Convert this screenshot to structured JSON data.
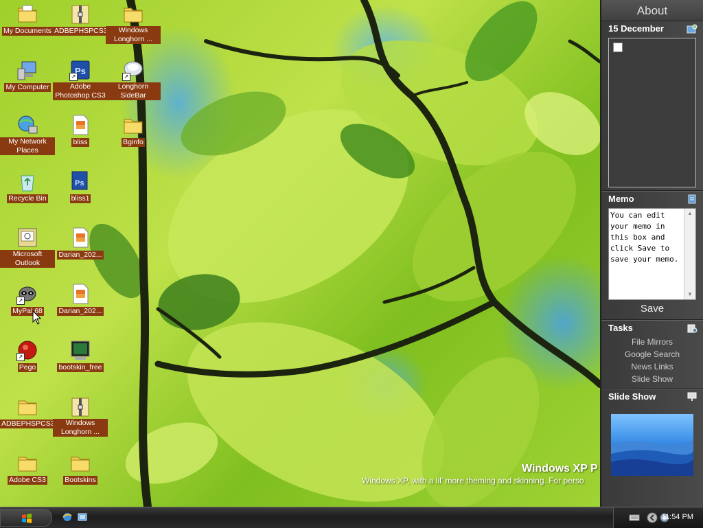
{
  "desktop_icons": [
    {
      "label": "My Documents",
      "icon": "my-documents-icon"
    },
    {
      "label": "ADBEPHSPCS3",
      "icon": "folder-zip-icon"
    },
    {
      "label": "Windows Longhorn ...",
      "icon": "folder-icon"
    },
    {
      "label": "My Computer",
      "icon": "computer-icon"
    },
    {
      "label": "Adobe Photoshop CS3",
      "icon": "photoshop-icon"
    },
    {
      "label": "Longhorn SideBar",
      "icon": "sidebar-app-icon"
    },
    {
      "label": "My Network Places",
      "icon": "network-icon"
    },
    {
      "label": "bliss",
      "icon": "image-file-icon"
    },
    {
      "label": "Bginfo",
      "icon": "folder-icon"
    },
    {
      "label": "Recycle Bin",
      "icon": "recycle-bin-icon"
    },
    {
      "label": "bliss1",
      "icon": "psd-file-icon"
    },
    {
      "label": "Microsoft Outlook",
      "icon": "outlook-icon"
    },
    {
      "label": "Darian_202...",
      "icon": "image-file-icon"
    },
    {
      "label": "MyPal 68",
      "icon": "raccoon-app-icon"
    },
    {
      "label": "Darian_202...",
      "icon": "image-file-icon"
    },
    {
      "label": "Pego",
      "icon": "pego-icon"
    },
    {
      "label": "bootskin_free",
      "icon": "bootskin-icon"
    },
    {
      "label": "ADBEPHSPCS3",
      "icon": "folder-icon"
    },
    {
      "label": "Windows Longhorn ...",
      "icon": "folder-zip-icon"
    },
    {
      "label": "Adobe CS3",
      "icon": "folder-icon"
    },
    {
      "label": "Bootskins",
      "icon": "folder-icon"
    }
  ],
  "watermark": {
    "title": "Windows XP P",
    "subtitle": "Windows XP, with a lil' more theming and skinning. For perso"
  },
  "sidebar": {
    "about_label": "About",
    "calendar": {
      "date_label": "15 December"
    },
    "memo": {
      "title": "Memo",
      "text": "You can edit your memo in this box and click Save to save your memo.",
      "save_label": "Save"
    },
    "tasks": {
      "title": "Tasks",
      "items": [
        "File Mirrors",
        "Google Search",
        "News Links",
        "Slide Show"
      ]
    },
    "slideshow": {
      "title": "Slide Show"
    }
  },
  "taskbar": {
    "clock": "11:54 PM"
  },
  "colors": {
    "icon_label_bg": "#8a3a10",
    "sidebar_bg": "#404040",
    "taskbar_bg": "#2a2a2a"
  }
}
